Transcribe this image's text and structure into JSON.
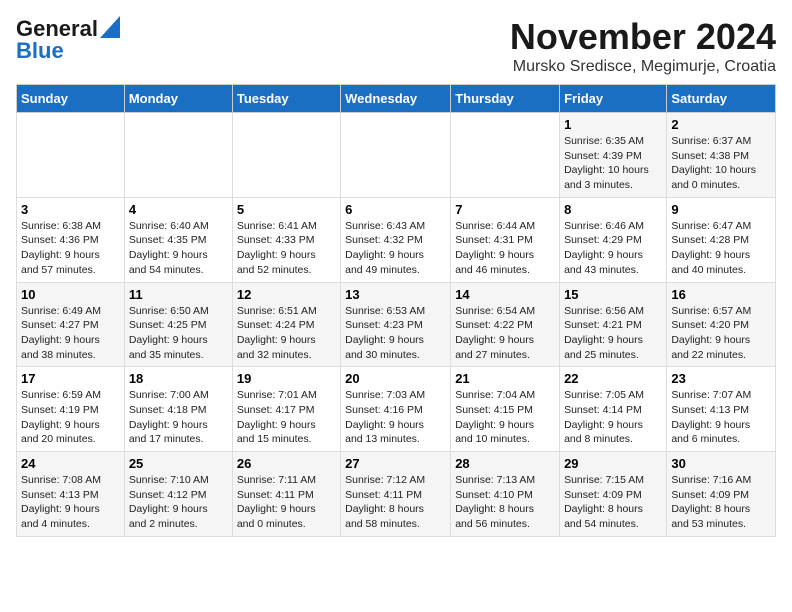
{
  "header": {
    "logo_line1": "General",
    "logo_line2": "Blue",
    "main_title": "November 2024",
    "subtitle": "Mursko Sredisce, Megimurje, Croatia"
  },
  "weekdays": [
    "Sunday",
    "Monday",
    "Tuesday",
    "Wednesday",
    "Thursday",
    "Friday",
    "Saturday"
  ],
  "weeks": [
    [
      {
        "day": "",
        "info": ""
      },
      {
        "day": "",
        "info": ""
      },
      {
        "day": "",
        "info": ""
      },
      {
        "day": "",
        "info": ""
      },
      {
        "day": "",
        "info": ""
      },
      {
        "day": "1",
        "info": "Sunrise: 6:35 AM\nSunset: 4:39 PM\nDaylight: 10 hours\nand 3 minutes."
      },
      {
        "day": "2",
        "info": "Sunrise: 6:37 AM\nSunset: 4:38 PM\nDaylight: 10 hours\nand 0 minutes."
      }
    ],
    [
      {
        "day": "3",
        "info": "Sunrise: 6:38 AM\nSunset: 4:36 PM\nDaylight: 9 hours\nand 57 minutes."
      },
      {
        "day": "4",
        "info": "Sunrise: 6:40 AM\nSunset: 4:35 PM\nDaylight: 9 hours\nand 54 minutes."
      },
      {
        "day": "5",
        "info": "Sunrise: 6:41 AM\nSunset: 4:33 PM\nDaylight: 9 hours\nand 52 minutes."
      },
      {
        "day": "6",
        "info": "Sunrise: 6:43 AM\nSunset: 4:32 PM\nDaylight: 9 hours\nand 49 minutes."
      },
      {
        "day": "7",
        "info": "Sunrise: 6:44 AM\nSunset: 4:31 PM\nDaylight: 9 hours\nand 46 minutes."
      },
      {
        "day": "8",
        "info": "Sunrise: 6:46 AM\nSunset: 4:29 PM\nDaylight: 9 hours\nand 43 minutes."
      },
      {
        "day": "9",
        "info": "Sunrise: 6:47 AM\nSunset: 4:28 PM\nDaylight: 9 hours\nand 40 minutes."
      }
    ],
    [
      {
        "day": "10",
        "info": "Sunrise: 6:49 AM\nSunset: 4:27 PM\nDaylight: 9 hours\nand 38 minutes."
      },
      {
        "day": "11",
        "info": "Sunrise: 6:50 AM\nSunset: 4:25 PM\nDaylight: 9 hours\nand 35 minutes."
      },
      {
        "day": "12",
        "info": "Sunrise: 6:51 AM\nSunset: 4:24 PM\nDaylight: 9 hours\nand 32 minutes."
      },
      {
        "day": "13",
        "info": "Sunrise: 6:53 AM\nSunset: 4:23 PM\nDaylight: 9 hours\nand 30 minutes."
      },
      {
        "day": "14",
        "info": "Sunrise: 6:54 AM\nSunset: 4:22 PM\nDaylight: 9 hours\nand 27 minutes."
      },
      {
        "day": "15",
        "info": "Sunrise: 6:56 AM\nSunset: 4:21 PM\nDaylight: 9 hours\nand 25 minutes."
      },
      {
        "day": "16",
        "info": "Sunrise: 6:57 AM\nSunset: 4:20 PM\nDaylight: 9 hours\nand 22 minutes."
      }
    ],
    [
      {
        "day": "17",
        "info": "Sunrise: 6:59 AM\nSunset: 4:19 PM\nDaylight: 9 hours\nand 20 minutes."
      },
      {
        "day": "18",
        "info": "Sunrise: 7:00 AM\nSunset: 4:18 PM\nDaylight: 9 hours\nand 17 minutes."
      },
      {
        "day": "19",
        "info": "Sunrise: 7:01 AM\nSunset: 4:17 PM\nDaylight: 9 hours\nand 15 minutes."
      },
      {
        "day": "20",
        "info": "Sunrise: 7:03 AM\nSunset: 4:16 PM\nDaylight: 9 hours\nand 13 minutes."
      },
      {
        "day": "21",
        "info": "Sunrise: 7:04 AM\nSunset: 4:15 PM\nDaylight: 9 hours\nand 10 minutes."
      },
      {
        "day": "22",
        "info": "Sunrise: 7:05 AM\nSunset: 4:14 PM\nDaylight: 9 hours\nand 8 minutes."
      },
      {
        "day": "23",
        "info": "Sunrise: 7:07 AM\nSunset: 4:13 PM\nDaylight: 9 hours\nand 6 minutes."
      }
    ],
    [
      {
        "day": "24",
        "info": "Sunrise: 7:08 AM\nSunset: 4:13 PM\nDaylight: 9 hours\nand 4 minutes."
      },
      {
        "day": "25",
        "info": "Sunrise: 7:10 AM\nSunset: 4:12 PM\nDaylight: 9 hours\nand 2 minutes."
      },
      {
        "day": "26",
        "info": "Sunrise: 7:11 AM\nSunset: 4:11 PM\nDaylight: 9 hours\nand 0 minutes."
      },
      {
        "day": "27",
        "info": "Sunrise: 7:12 AM\nSunset: 4:11 PM\nDaylight: 8 hours\nand 58 minutes."
      },
      {
        "day": "28",
        "info": "Sunrise: 7:13 AM\nSunset: 4:10 PM\nDaylight: 8 hours\nand 56 minutes."
      },
      {
        "day": "29",
        "info": "Sunrise: 7:15 AM\nSunset: 4:09 PM\nDaylight: 8 hours\nand 54 minutes."
      },
      {
        "day": "30",
        "info": "Sunrise: 7:16 AM\nSunset: 4:09 PM\nDaylight: 8 hours\nand 53 minutes."
      }
    ]
  ]
}
